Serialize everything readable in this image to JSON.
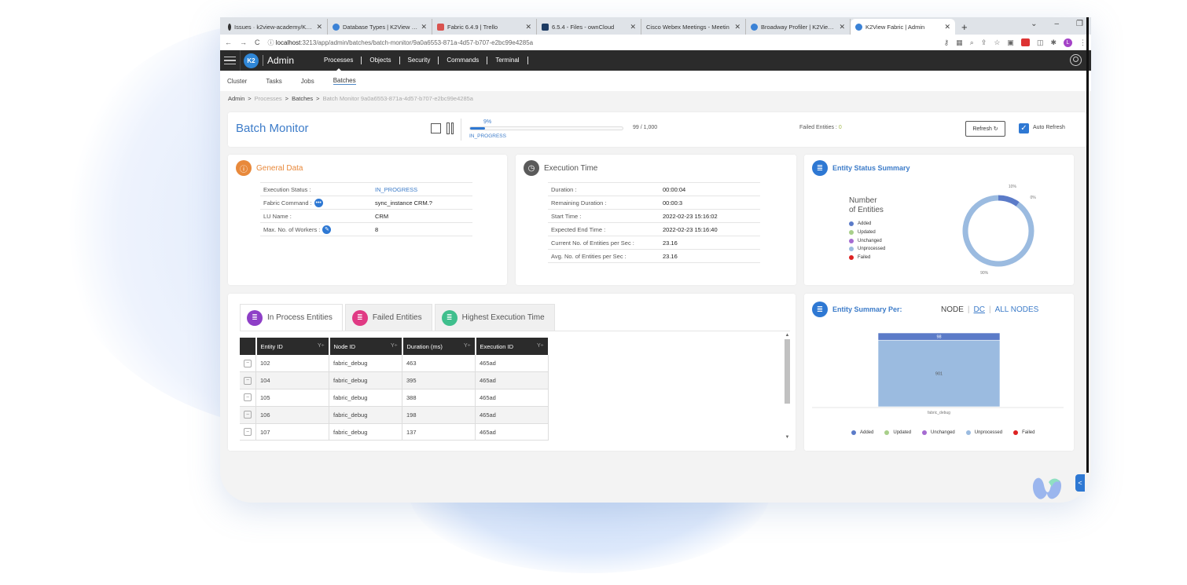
{
  "browser": {
    "tabs": [
      {
        "title": "Issues · k2view-academy/K2Vie",
        "icon": "github-icon"
      },
      {
        "title": "Database Types | K2View Suppo",
        "icon": "k2view-support-icon"
      },
      {
        "title": "Fabric 6.4.9 | Trello",
        "icon": "trello-icon"
      },
      {
        "title": "6.5.4 - Files - ownCloud",
        "icon": "owncloud-icon"
      },
      {
        "title": "Cisco Webex Meetings - Meetin",
        "icon": "webex-icon"
      },
      {
        "title": "Broadway Profiler | K2View Sup",
        "icon": "k2view-support-icon"
      },
      {
        "title": "K2View Fabric | Admin",
        "icon": "k2view-icon",
        "active": true
      }
    ],
    "new_tab": "+",
    "url_host": "localhost",
    "url_rest": ":3213/app/admin/batches/batch-monitor/9a0a6553-871a-4d57-b707-e2bc99e4285a",
    "profile_initial": "L"
  },
  "appnav": {
    "logo": "K2",
    "app_name": "Admin",
    "items": [
      "Processes",
      "Objects",
      "Security",
      "Commands",
      "Terminal"
    ],
    "active": "Processes"
  },
  "subnav": {
    "items": [
      "Cluster",
      "Tasks",
      "Jobs",
      "Batches"
    ],
    "active": "Batches"
  },
  "breadcrumb": {
    "items": [
      "Admin",
      "Processes",
      "Batches",
      "Batch Monitor 9a0a6553-871a-4d57-b707-e2bc99e4285a"
    ],
    "sep": ">"
  },
  "header": {
    "title": "Batch Monitor",
    "progress_percent_label": "9%",
    "progress_fraction": 0.099,
    "progress_status": "IN_PROGRESS",
    "progress_count": "99 / 1,000",
    "failed_label": "Failed Entities :",
    "failed_value": "0",
    "refresh_label": "Refresh ↻",
    "auto_refresh_label": "Auto Refresh",
    "auto_refresh_checked": true
  },
  "general": {
    "title": "General Data",
    "rows": [
      {
        "label": "Execution Status :",
        "value": "IN_PROGRESS"
      },
      {
        "label": "Fabric Command :",
        "value": "sync_instance CRM.?"
      },
      {
        "label": "LU Name :",
        "value": "CRM"
      },
      {
        "label": "Max. No. of Workers :",
        "value": "8"
      }
    ]
  },
  "execution": {
    "title": "Execution Time",
    "rows": [
      {
        "label": "Duration :",
        "value": "00:00:04"
      },
      {
        "label": "Remaining Duration :",
        "value": "00:00:3"
      },
      {
        "label": "Start Time :",
        "value": "2022-02-23 15:16:02"
      },
      {
        "label": "Expected End Time :",
        "value": "2022-02-23 15:16:40"
      },
      {
        "label": "Current No. of Entities per Sec :",
        "value": "23.16"
      },
      {
        "label": "Avg. No. of Entities per Sec :",
        "value": "23.16"
      }
    ]
  },
  "status_summary": {
    "title": "Entity Status Summary",
    "legend_title_1": "Number",
    "legend_title_2": "of Entities"
  },
  "entities": {
    "tabs": [
      "In Process Entities",
      "Failed Entities",
      "Highest Execution Time"
    ],
    "active_tab": "In Process Entities",
    "columns": [
      "Entity ID",
      "Node ID",
      "Duration (ms)",
      "Execution ID"
    ],
    "filter_icon": "Y÷",
    "row_button": "−",
    "rows": [
      [
        "102",
        "fabric_debug",
        "463",
        "465ad"
      ],
      [
        "104",
        "fabric_debug",
        "395",
        "465ad"
      ],
      [
        "105",
        "fabric_debug",
        "388",
        "465ad"
      ],
      [
        "106",
        "fabric_debug",
        "198",
        "465ad"
      ],
      [
        "107",
        "fabric_debug",
        "137",
        "465ad"
      ]
    ]
  },
  "summary_per": {
    "title": "Entity Summary Per:",
    "options": [
      "NODE",
      "DC",
      "ALL NODES"
    ],
    "sep": "|"
  },
  "colors": {
    "Added": "#5b7bc8",
    "Updated": "#a8cf8a",
    "Unchanged": "#a56bd1",
    "Unprocessed": "#9bbbe0",
    "Failed": "#dd2222",
    "accent": "#2e78d3"
  },
  "chart_data": [
    {
      "type": "pie",
      "title": "Number of Entities",
      "legend": [
        "Added",
        "Updated",
        "Unchanged",
        "Unprocessed",
        "Failed"
      ],
      "legend_position": "left",
      "values": [
        10,
        0,
        0,
        90,
        0
      ],
      "labels": [
        "10%",
        "0%",
        "0%",
        "90%",
        "0%"
      ],
      "donut": true
    },
    {
      "type": "bar",
      "stacked": true,
      "categories": [
        "fabric_debug"
      ],
      "series": [
        {
          "name": "Added",
          "values": [
            98
          ]
        },
        {
          "name": "Updated",
          "values": [
            0
          ]
        },
        {
          "name": "Unchanged",
          "values": [
            0
          ]
        },
        {
          "name": "Unprocessed",
          "values": [
            901
          ]
        },
        {
          "name": "Failed",
          "values": [
            0
          ]
        }
      ],
      "legend": [
        "Added",
        "Updated",
        "Unchanged",
        "Unprocessed",
        "Failed"
      ],
      "legend_position": "bottom",
      "xlabel": "",
      "ylabel": ""
    }
  ]
}
